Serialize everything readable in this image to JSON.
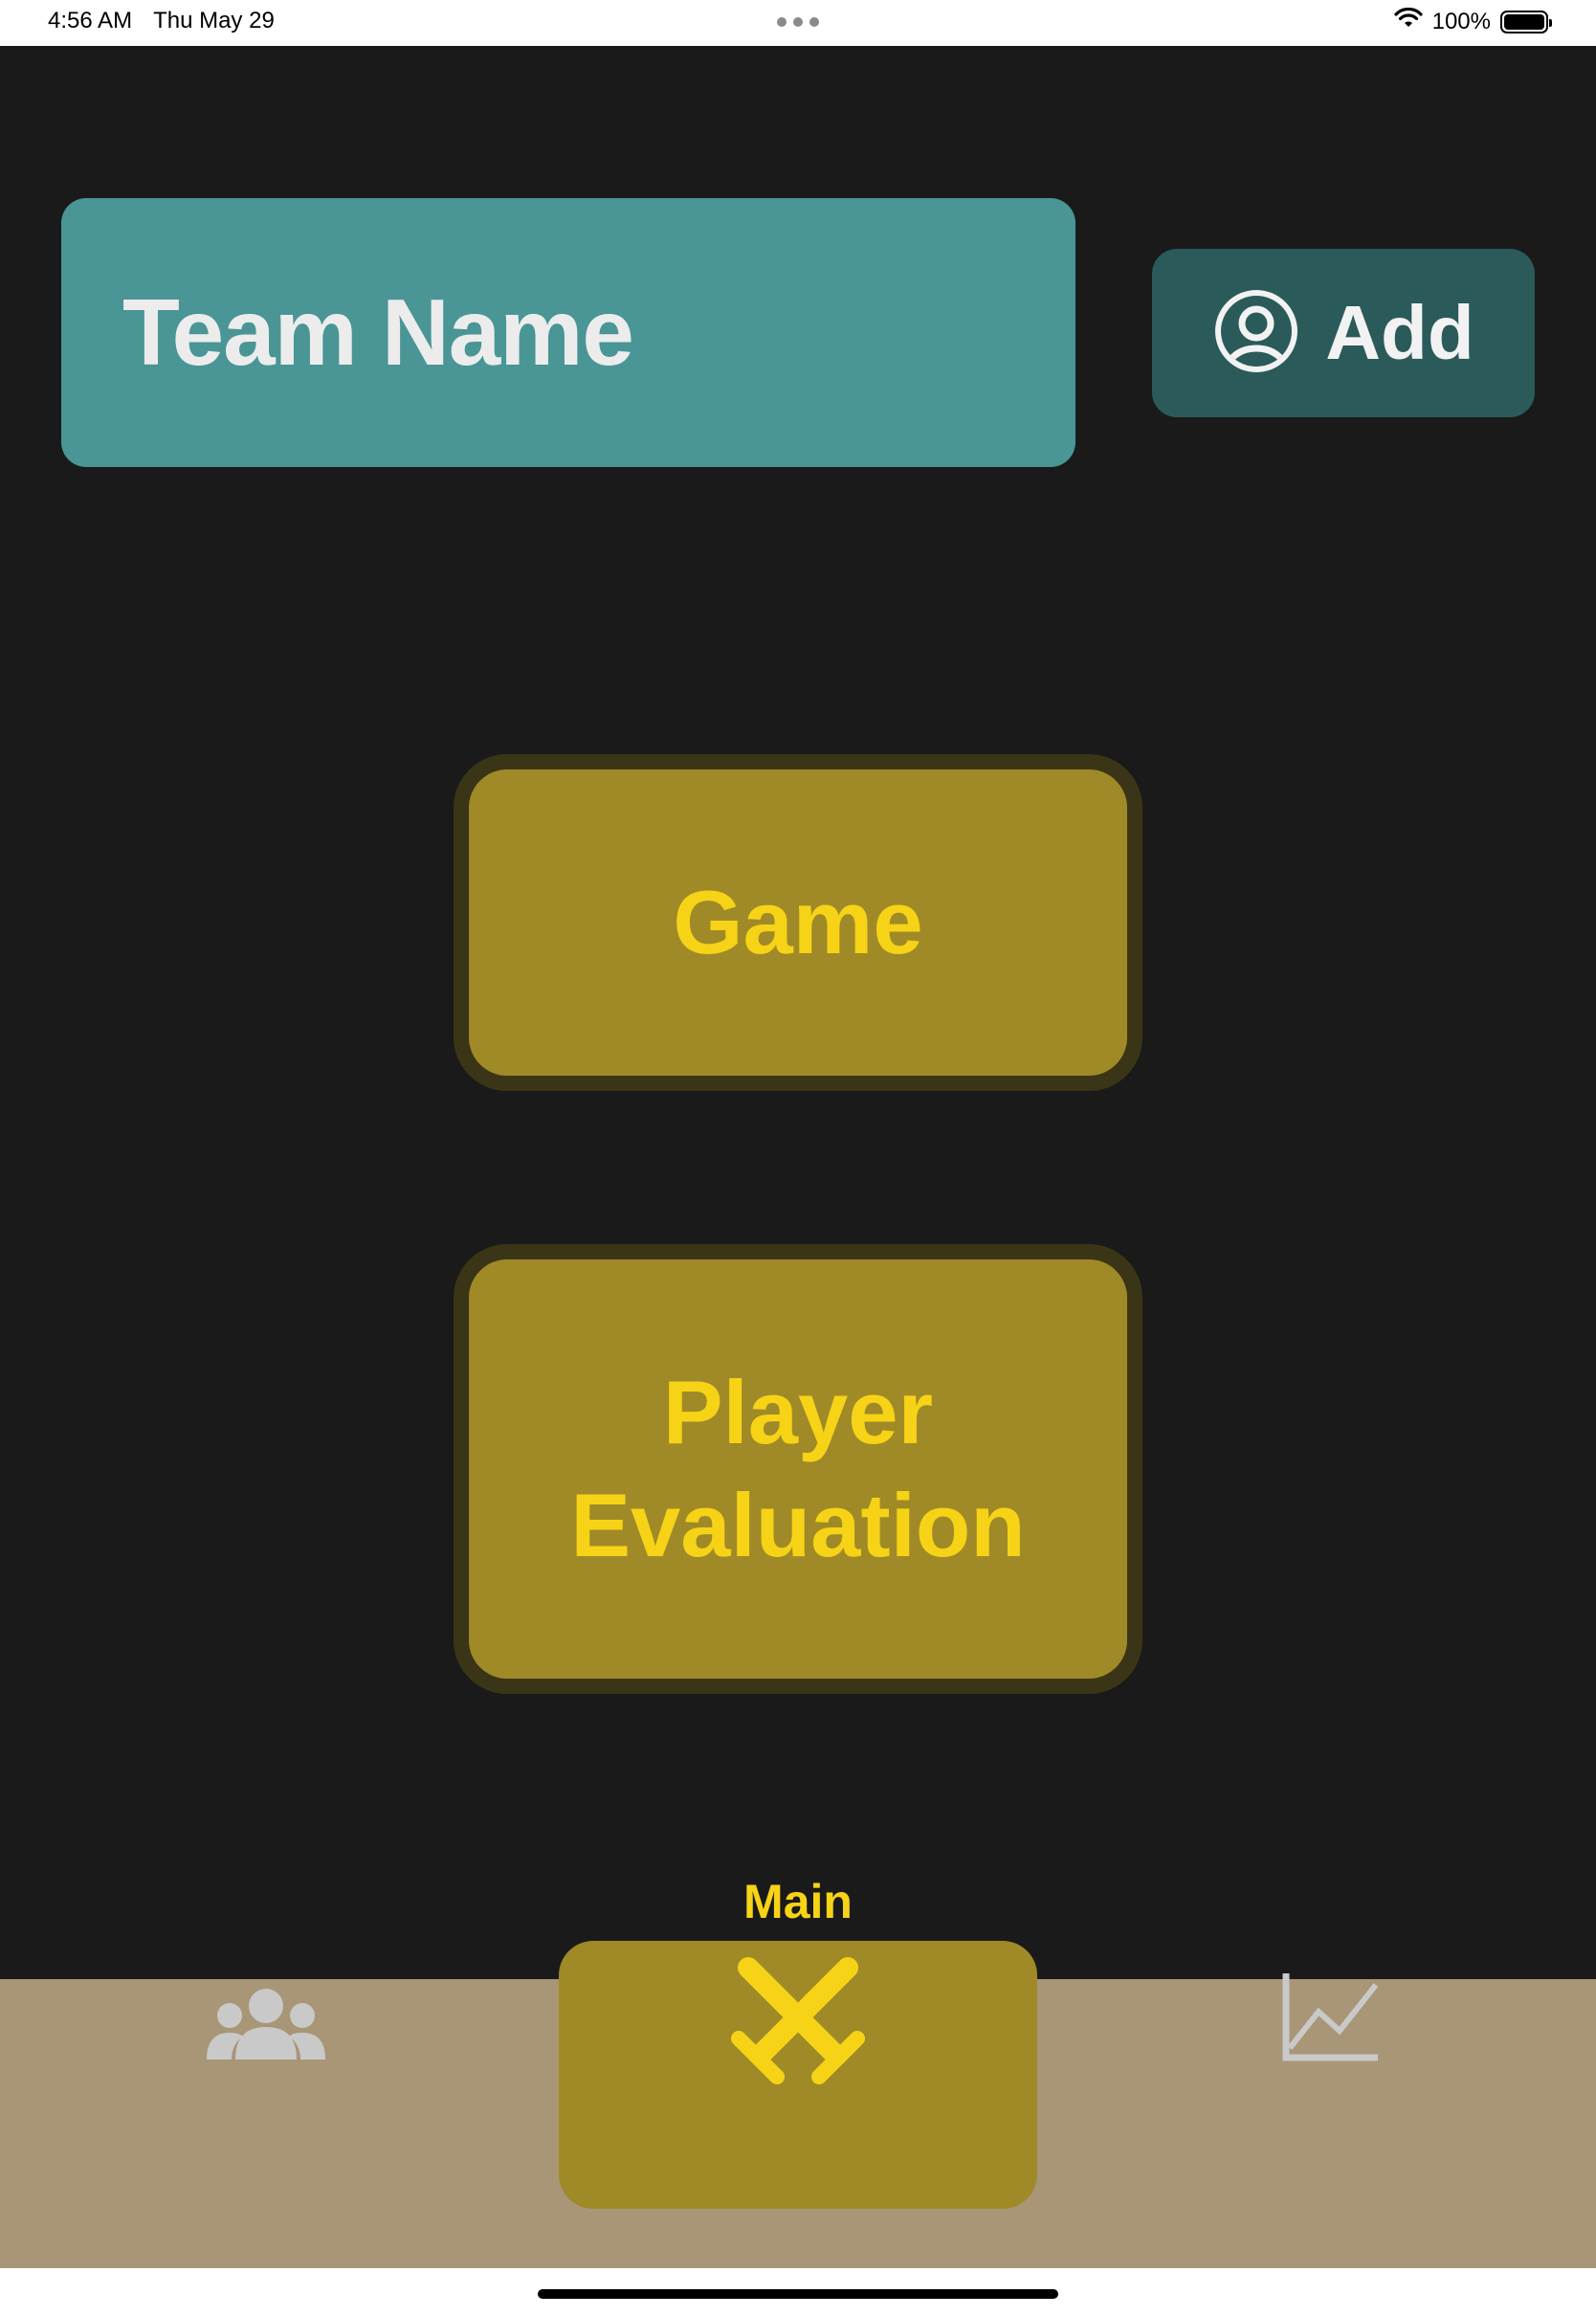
{
  "status_bar": {
    "time": "4:56 AM",
    "date": "Thu May 29",
    "battery": "100%",
    "icons": [
      "wifi-icon",
      "battery-icon"
    ]
  },
  "team": {
    "name": "Team Name",
    "background_color": "#4a9595"
  },
  "add_button": {
    "label": "Add",
    "icon": "person-circle-icon",
    "background_color": "#2b5a5a"
  },
  "actions": {
    "game_label": "Game",
    "player_evaluation_line1": "Player",
    "player_evaluation_line2": "Evaluation",
    "accent_color": "#f6d316",
    "button_color": "#a08a27"
  },
  "tab_bar": {
    "background_color": "#a89677",
    "tabs": [
      {
        "icon": "people-group-icon",
        "label": "",
        "selected": false
      },
      {
        "icon": "crossed-swords-icon",
        "label": "Main",
        "selected": true
      },
      {
        "icon": "line-chart-icon",
        "label": "",
        "selected": false
      }
    ]
  }
}
